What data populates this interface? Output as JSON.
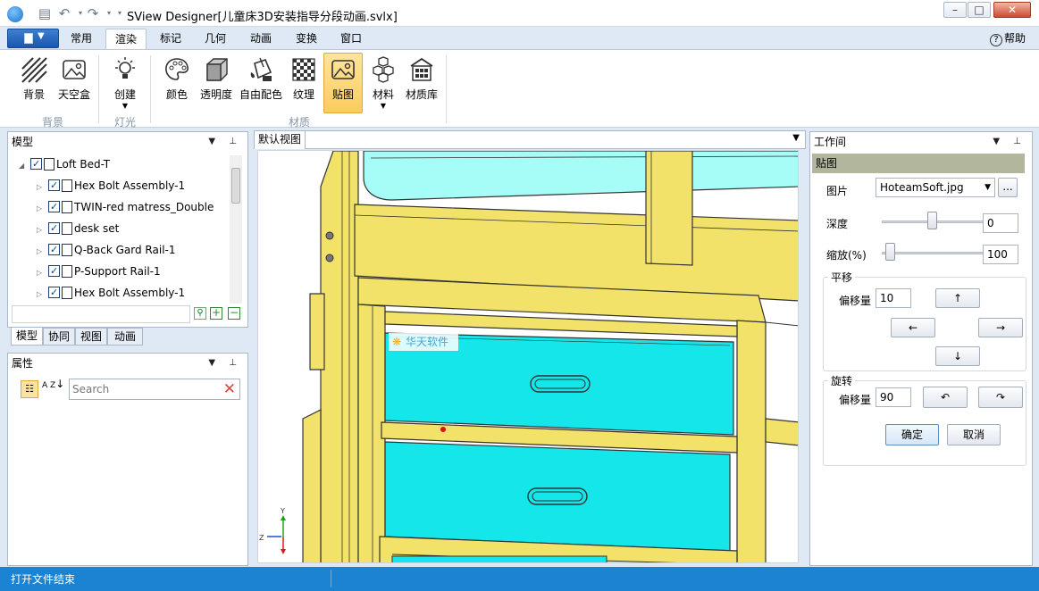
{
  "window": {
    "title": "SView Designer[儿童床3D安装指导分段动画.svlx]"
  },
  "quick_access": {
    "icons": [
      "save-icon",
      "undo-icon",
      "redo-icon"
    ]
  },
  "ribbon_tabs": [
    "常用",
    "渲染",
    "标记",
    "几何",
    "动画",
    "变换",
    "窗口"
  ],
  "active_tab": "渲染",
  "help_label": "帮助",
  "ribbon": {
    "groups": {
      "background": "背景",
      "light": "灯光",
      "material": "材质"
    },
    "buttons": {
      "background": "背景",
      "skybox": "天空盒",
      "create": "创建",
      "color": "颜色",
      "transparency": "透明度",
      "free_color": "自由配色",
      "texture": "纹理",
      "decal": "贴图",
      "material": "材料",
      "material_lib": "材质库"
    }
  },
  "model_panel": {
    "title": "模型",
    "items": [
      {
        "label": "Loft Bed-T",
        "level": 0,
        "expander": "◢"
      },
      {
        "label": "Hex Bolt Assembly-1",
        "level": 1,
        "expander": "▷"
      },
      {
        "label": "TWIN-red matress_Double",
        "level": 1,
        "expander": "▷"
      },
      {
        "label": "desk set",
        "level": 1,
        "expander": "▷"
      },
      {
        "label": "Q-Back Gard Rail-1",
        "level": 1,
        "expander": "▷"
      },
      {
        "label": "P-Support Rail-1",
        "level": 1,
        "expander": "▷"
      },
      {
        "label": "Hex Bolt Assembly-1",
        "level": 1,
        "expander": "▷"
      }
    ],
    "bottom_tabs": [
      "模型",
      "协同",
      "视图",
      "动画"
    ]
  },
  "properties_panel": {
    "title": "属性",
    "search_placeholder": "Search",
    "sort_label": "A Z"
  },
  "viewport": {
    "tab": "默认视图",
    "watermark": "华天软件",
    "axis_labels": {
      "z": "Z",
      "y": "Y"
    }
  },
  "workspace": {
    "title": "工作间",
    "section": "贴图",
    "image_label": "图片",
    "image_value": "HoteamSoft.jpg",
    "browse": "...",
    "depth_label": "深度",
    "depth_value": "0",
    "depth_fraction": 0.37,
    "scale_label": "缩放(%)",
    "scale_value": "100",
    "scale_fraction": 0.03,
    "pan_group": "平移",
    "pan_offset_label": "偏移量",
    "pan_offset_value": "10",
    "arrow_up": "↑",
    "arrow_left": "←",
    "arrow_right": "→",
    "arrow_down": "↓",
    "rotate_group": "旋转",
    "rotate_offset_label": "偏移量",
    "rotate_offset_value": "90",
    "rotate_ccw": "↶",
    "rotate_cw": "↷",
    "ok": "确定",
    "cancel": "取消"
  },
  "status": {
    "text": "打开文件结束"
  },
  "colors": {
    "accent": "#1b83d2",
    "active_ribbon": "#fbcb5e",
    "wood": "#f3e26a",
    "drawer": "#14e6ea",
    "mattress": "#a6fcf6"
  }
}
